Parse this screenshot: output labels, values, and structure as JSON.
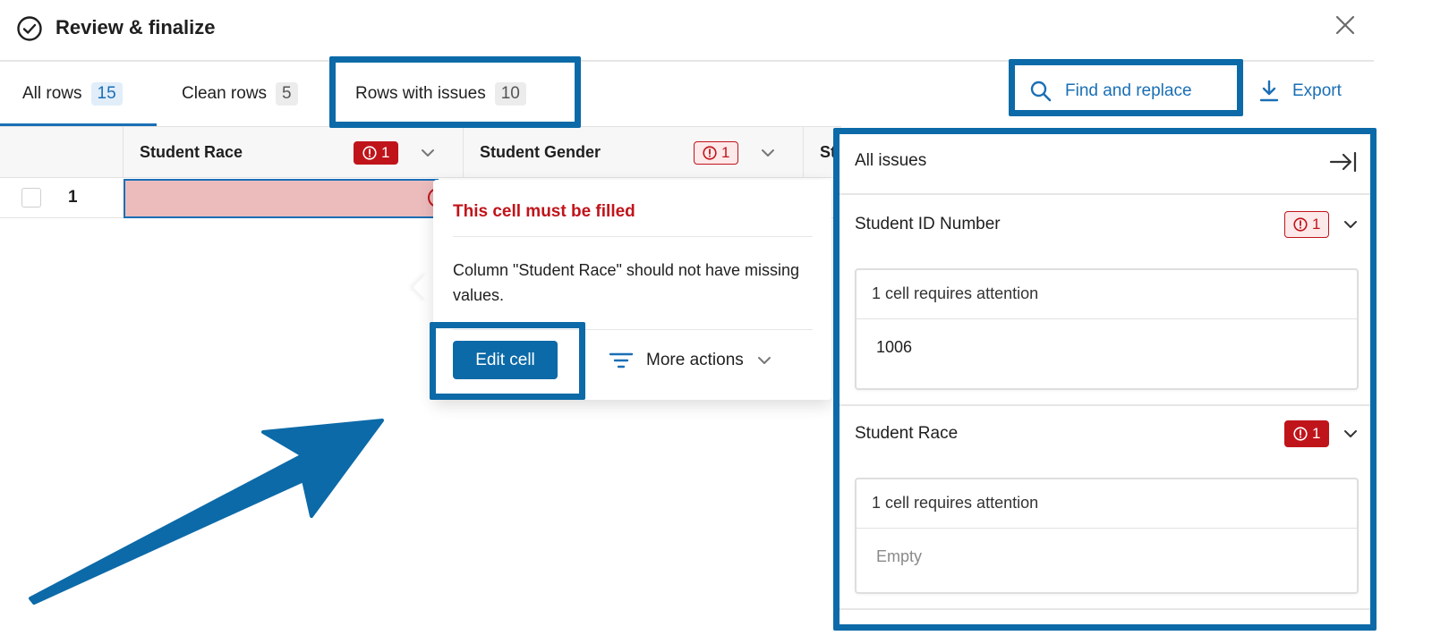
{
  "header": {
    "title": "Review & finalize"
  },
  "tabs": [
    {
      "label": "All rows",
      "count": "15"
    },
    {
      "label": "Clean rows",
      "count": "5"
    },
    {
      "label": "Rows with issues",
      "count": "10"
    }
  ],
  "toolbar": {
    "find_replace": "Find and replace",
    "export": "Export"
  },
  "grid": {
    "columns": [
      {
        "name": "Student Race",
        "issue_count": "1"
      },
      {
        "name": "Student Gender",
        "issue_count": "1"
      },
      {
        "name": "St"
      }
    ],
    "row_number": "1"
  },
  "popover": {
    "title": "This cell must be filled",
    "body": "Column \"Student Race\" should not have missing values.",
    "edit_button": "Edit cell",
    "more_actions": "More actions"
  },
  "panel": {
    "title": "All issues",
    "issues": [
      {
        "column": "Student ID Number",
        "count": "1",
        "summary": "1 cell requires attention",
        "value": "1006"
      },
      {
        "column": "Student Race",
        "count": "1",
        "summary": "1 cell requires attention",
        "value": "Empty"
      }
    ]
  },
  "colors": {
    "accent": "#0c6aa8",
    "error": "#c0141b",
    "error_cell": "#ecbcbd"
  }
}
